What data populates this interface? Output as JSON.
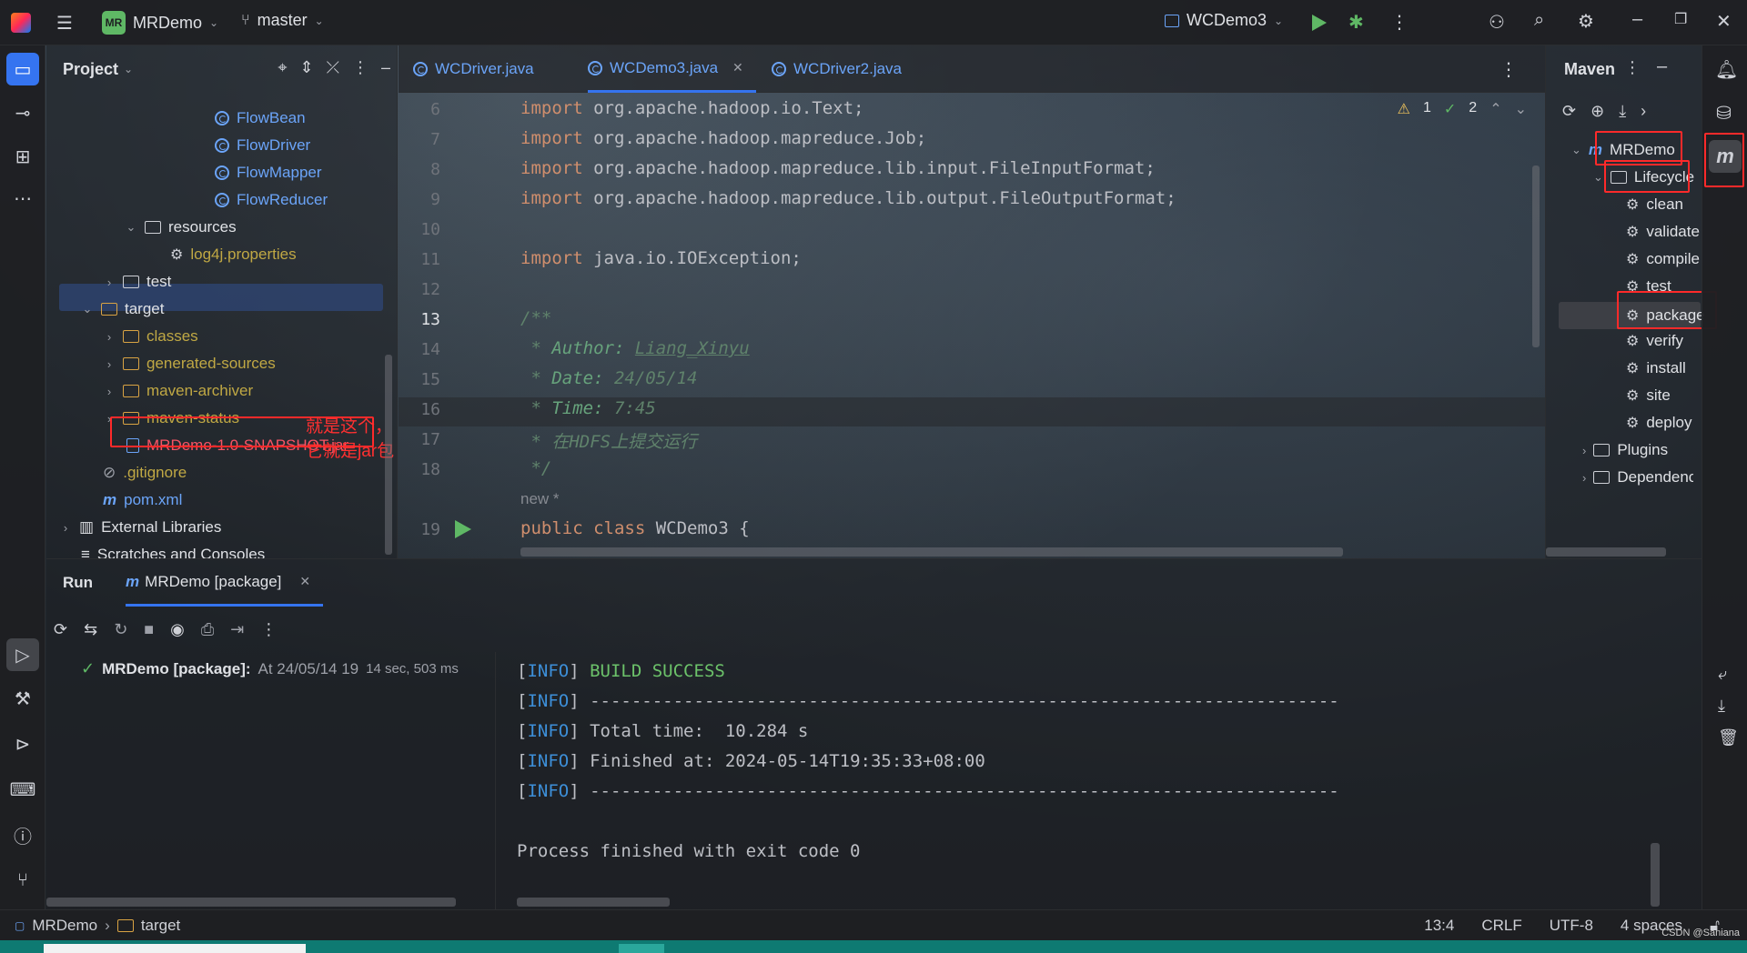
{
  "window": {
    "project_name": "MRDemo",
    "project_badge": "MR",
    "branch": "master",
    "run_config": "WCDemo3"
  },
  "project_panel": {
    "title": "Project",
    "tree": [
      {
        "label": "FlowBean",
        "kind": "class"
      },
      {
        "label": "FlowDriver",
        "kind": "class"
      },
      {
        "label": "FlowMapper",
        "kind": "class"
      },
      {
        "label": "FlowReducer",
        "kind": "class"
      },
      {
        "label": "resources",
        "kind": "folder"
      },
      {
        "label": "log4j.properties",
        "kind": "file"
      },
      {
        "label": "test",
        "kind": "folder"
      },
      {
        "label": "target",
        "kind": "folder"
      },
      {
        "label": "classes",
        "kind": "folder"
      },
      {
        "label": "generated-sources",
        "kind": "folder"
      },
      {
        "label": "maven-archiver",
        "kind": "folder"
      },
      {
        "label": "maven-status",
        "kind": "folder"
      },
      {
        "label": "MRDemo-1.0-SNAPSHOT.jar",
        "kind": "jar"
      },
      {
        "label": ".gitignore",
        "kind": "file"
      },
      {
        "label": "pom.xml",
        "kind": "maven"
      },
      {
        "label": "External Libraries",
        "kind": "lib"
      },
      {
        "label": "Scratches and Consoles",
        "kind": "scratch"
      }
    ],
    "annotation": "就是这个，它就是jar包"
  },
  "editor": {
    "tabs": [
      {
        "label": "WCDriver.java",
        "active": false
      },
      {
        "label": "WCDemo3.java",
        "active": true
      },
      {
        "label": "WCDriver2.java",
        "active": false
      }
    ],
    "inspections": {
      "warnings": "1",
      "weak_warnings": "2"
    },
    "lines": [
      {
        "num": "6",
        "code": "import org.apache.hadoop.io.Text;"
      },
      {
        "num": "7",
        "code": "import org.apache.hadoop.mapreduce.Job;"
      },
      {
        "num": "8",
        "code": "import org.apache.hadoop.mapreduce.lib.input.FileInputFormat;"
      },
      {
        "num": "9",
        "code": "import org.apache.hadoop.mapreduce.lib.output.FileOutputFormat;"
      },
      {
        "num": "10",
        "code": ""
      },
      {
        "num": "11",
        "code": "import java.io.IOException;"
      },
      {
        "num": "12",
        "code": ""
      },
      {
        "num": "13",
        "code": "/**"
      },
      {
        "num": "14",
        "code": " * Author: Liang_Xinyu"
      },
      {
        "num": "15",
        "code": " * Date: 24/05/14"
      },
      {
        "num": "16",
        "code": " * Time: 7:45"
      },
      {
        "num": "17",
        "code": " * 在HDFS上提交运行"
      },
      {
        "num": "18",
        "code": " */"
      },
      {
        "num": "19",
        "code": "public class WCDemo3 {"
      }
    ],
    "import_kw": "import",
    "doc_author_tag": "Author:",
    "doc_author_val": "Liang_Xinyu",
    "doc_date_tag": "Date:",
    "doc_date_val": "24/05/14",
    "doc_time_tag": "Time:",
    "doc_time_val": "7:45",
    "doc_desc": "在HDFS上提交运行",
    "inlay_hint": "new *",
    "class_kw": "public class",
    "class_name": "WCDemo3 {"
  },
  "maven_panel": {
    "title": "Maven",
    "root": "MRDemo",
    "lifecycle": "Lifecycle",
    "goals": [
      "clean",
      "validate",
      "compile",
      "test",
      "package",
      "verify",
      "install",
      "site",
      "deploy"
    ],
    "plugins": "Plugins",
    "dependencies": "Dependencies"
  },
  "run_panel": {
    "title": "Run",
    "tab": "MRDemo [package]",
    "result_label": "MRDemo [package]:",
    "result_time": "At 24/05/14 19",
    "result_duration": "14 sec, 503 ms",
    "console": {
      "info": "INFO",
      "build_success": "BUILD SUCCESS",
      "separator": "------------------------------------------------------------------------",
      "total_time": "Total time:  10.284 s",
      "finished_at": "Finished at: 2024-05-14T19:35:33+08:00",
      "exit": "Process finished with exit code 0"
    }
  },
  "status_bar": {
    "crumb_project": "MRDemo",
    "crumb_folder": "target",
    "position": "13:4",
    "line_sep": "CRLF",
    "encoding": "UTF-8",
    "indent": "4 spaces"
  },
  "watermark": "CSDN @Saniana",
  "colors": {
    "accent": "#3574f0",
    "annotation_red": "#ff2a2a",
    "success": "#6cc26a",
    "info": "#3d8fd8"
  }
}
